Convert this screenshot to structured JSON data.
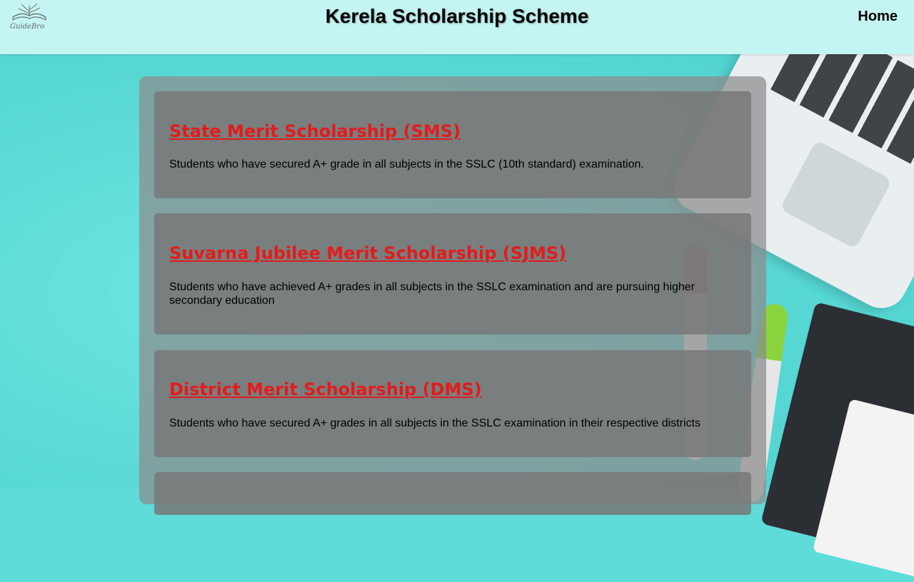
{
  "header": {
    "title": "Kerela Scholarship Scheme",
    "nav_home": "Home",
    "logo_text": "GuideBro"
  },
  "scholarships": [
    {
      "title": "State Merit Scholarship (SMS)",
      "description": "Students who have secured A+ grade in all subjects in the SSLC (10th standard) examination."
    },
    {
      "title": "Suvarna Jubilee Merit Scholarship (SJMS)",
      "description": "Students who have achieved A+ grades in all subjects in the SSLC examination and are pursuing higher secondary education"
    },
    {
      "title": "District Merit Scholarship (DMS)",
      "description": "Students who have secured A+ grades in all subjects in the SSLC examination in their respective districts"
    }
  ],
  "colors": {
    "header_bg": "#c4f5f2",
    "title_link": "#e31b1b",
    "background": "#5fdcd9"
  }
}
